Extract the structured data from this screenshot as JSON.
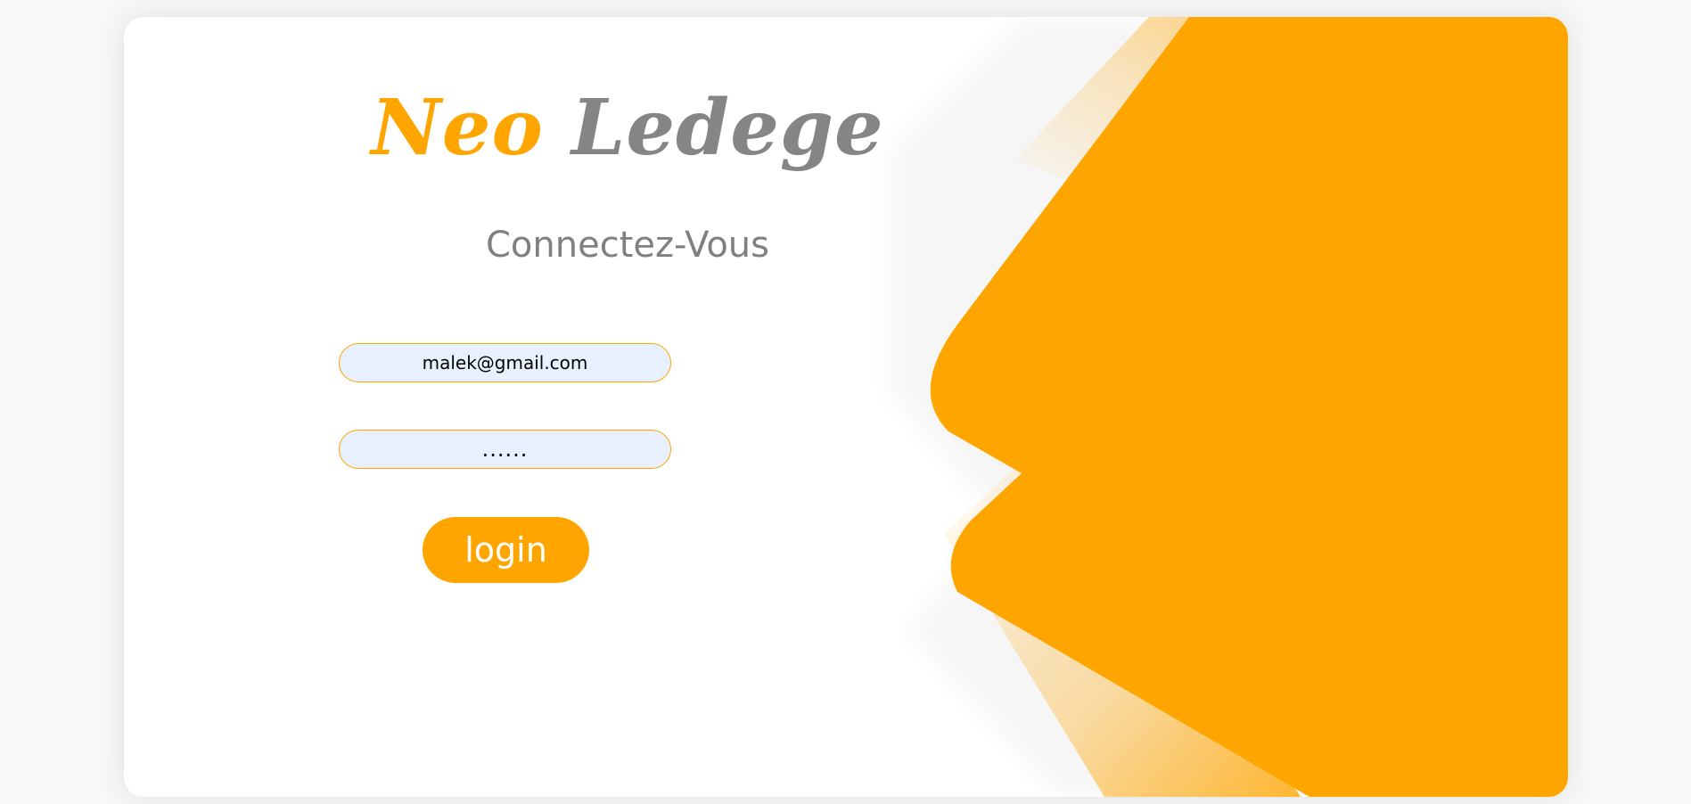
{
  "brand": {
    "word1": "Neo",
    "word2": "Ledege"
  },
  "login_form": {
    "heading": "Connectez-Vous",
    "email_value": "malek@gmail.com",
    "password_value": "......",
    "submit_label": "login"
  },
  "colors": {
    "accent": "#FFA500",
    "muted_text": "#858585",
    "input_background": "#E8F0FE",
    "card_background": "#FFFFFF"
  }
}
